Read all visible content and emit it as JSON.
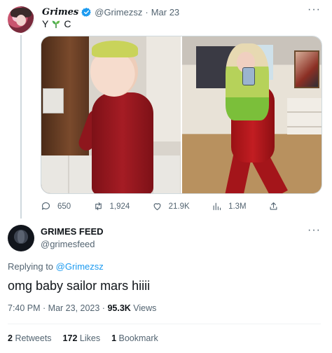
{
  "parent_tweet": {
    "display_name": "Grimes",
    "handle": "@Grimezsz",
    "separator": "·",
    "date": "Mar 23",
    "text_pre": "Y",
    "text_post": "C",
    "text_emoji": "sprout-icon",
    "more_label": "···",
    "actions": {
      "reply_count": "650",
      "retweet_count": "1,924",
      "like_count": "21.9K",
      "views_count": "1.3M"
    }
  },
  "reply": {
    "display_name": "GRIMES FEED",
    "handle": "@grimesfeed",
    "more_label": "···",
    "replying_prefix": "Replying to",
    "replying_to": "@Grimezsz",
    "text": "omg baby sailor mars hiiii",
    "time": "7:40 PM · Mar 23, 2023 ·",
    "views_value": "95.3K",
    "views_label": "Views",
    "stats": {
      "retweets_value": "2",
      "retweets_label": "Retweets",
      "likes_value": "172",
      "likes_label": "Likes",
      "bookmarks_value": "1",
      "bookmarks_label": "Bookmark"
    }
  },
  "colors": {
    "text": "#0f1419",
    "muted": "#536471",
    "accent": "#1d9bf0",
    "verified": "#1d9bf0",
    "sprout": "#4caf50"
  }
}
